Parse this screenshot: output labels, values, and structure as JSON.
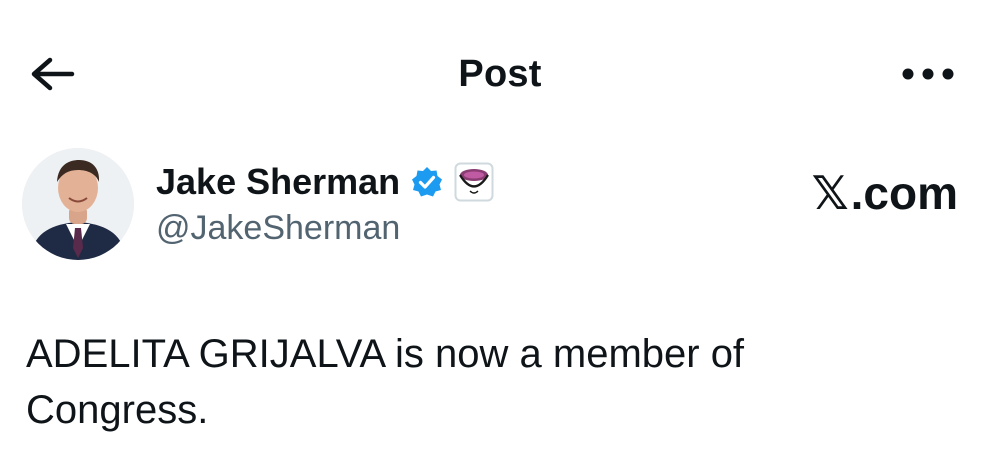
{
  "header": {
    "title": "Post",
    "back_icon": "arrow-left-icon",
    "more_icon": "more-horizontal-icon"
  },
  "author": {
    "display_name": "Jake Sherman",
    "handle": "@JakeSherman",
    "verified_badge": "verified-badge-icon",
    "affiliate_badge": "affiliate-badge-icon",
    "avatar": "avatar"
  },
  "source": {
    "label": ".com",
    "prefix_glyph": "𝕏"
  },
  "post": {
    "line1": "ADELITA GRIJALVA is now a member of",
    "line2": "Congress."
  },
  "colors": {
    "text": "#0f1419",
    "secondary": "#536471",
    "verified": "#1d9bf0"
  }
}
